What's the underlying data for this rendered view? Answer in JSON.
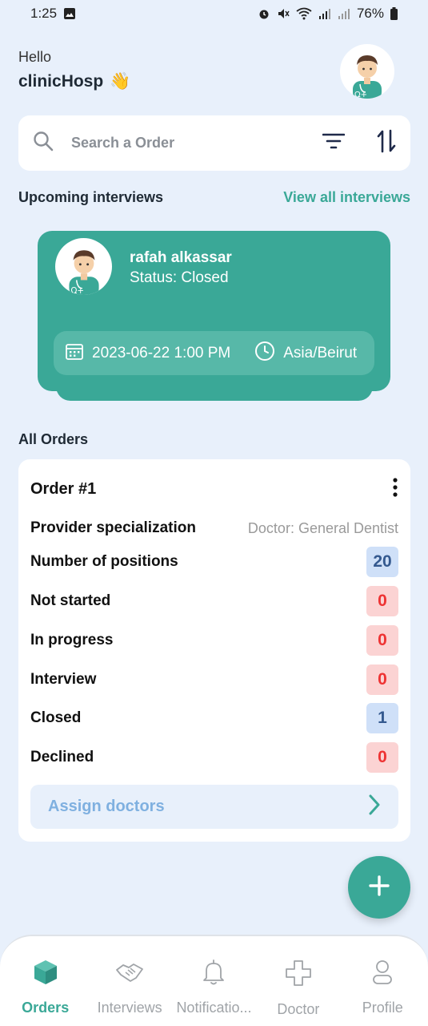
{
  "status_bar": {
    "time": "1:25",
    "battery": "76%"
  },
  "header": {
    "greeting": "Hello",
    "user_name": "clinicHosp",
    "wave": "👋"
  },
  "search": {
    "placeholder": "Search a Order"
  },
  "upcoming": {
    "title": "Upcoming interviews",
    "view_all": "View all interviews"
  },
  "interview": {
    "name": "rafah alkassar",
    "status": "Status: Closed",
    "datetime": "2023-06-22 1:00 PM",
    "timezone": "Asia/Beirut"
  },
  "orders": {
    "title": "All Orders",
    "order": {
      "title": "Order #1",
      "rows": [
        {
          "label": "Provider specialization",
          "value": "Doctor: General Dentist"
        },
        {
          "label": "Number of positions",
          "value": "20"
        },
        {
          "label": "Not started",
          "value": "0"
        },
        {
          "label": "In progress",
          "value": "0"
        },
        {
          "label": "Interview",
          "value": "0"
        },
        {
          "label": "Closed",
          "value": "1"
        },
        {
          "label": "Declined",
          "value": "0"
        }
      ],
      "assign_label": "Assign doctors"
    }
  },
  "fab": {
    "label": "+"
  },
  "nav": {
    "items": [
      {
        "label": "Orders",
        "icon": "cube-icon"
      },
      {
        "label": "Interviews",
        "icon": "handshake-icon"
      },
      {
        "label": "Notificatio...",
        "icon": "bell-icon"
      },
      {
        "label": "Doctor",
        "icon": "medical-cross-icon"
      },
      {
        "label": "Profile",
        "icon": "user-icon"
      }
    ]
  },
  "colors": {
    "accent": "#3aa897",
    "badge_blue": "#cfe0f8",
    "badge_red": "#fbd3d3"
  }
}
